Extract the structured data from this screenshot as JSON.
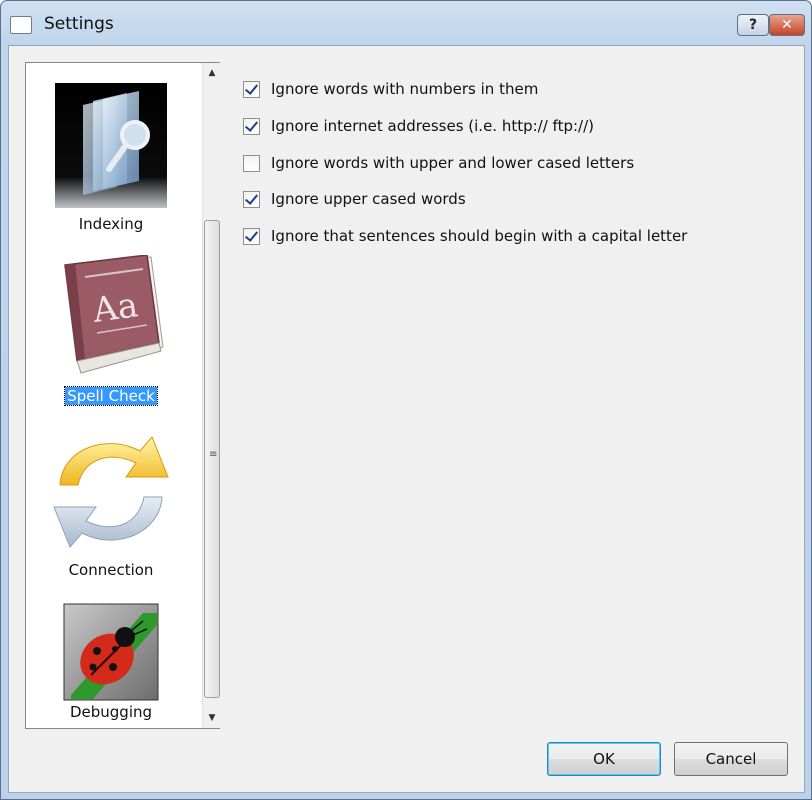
{
  "window": {
    "title": "Settings",
    "help_label": "?",
    "close_label": "✕"
  },
  "nav": {
    "items": [
      {
        "label": "Indexing",
        "icon": "indexing-icon",
        "selected": false
      },
      {
        "label": "Spell Check",
        "icon": "dictionary-book-icon",
        "selected": true
      },
      {
        "label": "Connection",
        "icon": "sync-arrows-icon",
        "selected": false
      },
      {
        "label": "Debugging",
        "icon": "ladybug-icon",
        "selected": false
      }
    ],
    "book_text": "Aa"
  },
  "options": [
    {
      "label": "Ignore words with numbers in them",
      "checked": true
    },
    {
      "label": "Ignore internet addresses (i.e. http:// ftp://)",
      "checked": true
    },
    {
      "label": "Ignore words with upper and lower cased letters",
      "checked": false
    },
    {
      "label": "Ignore upper cased words",
      "checked": true
    },
    {
      "label": "Ignore that sentences should begin with a capital letter",
      "checked": true
    }
  ],
  "buttons": {
    "ok": "OK",
    "cancel": "Cancel"
  },
  "scrollbar": {
    "up_arrow": "▲",
    "down_arrow": "▼",
    "grip": "≡"
  }
}
